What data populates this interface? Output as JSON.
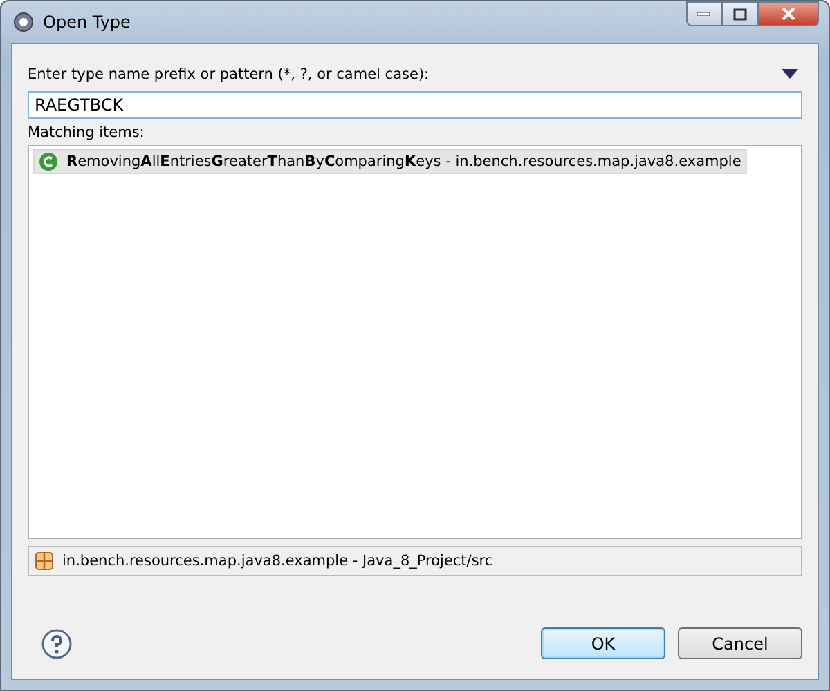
{
  "window": {
    "title": "Open Type"
  },
  "pattern": {
    "label": "Enter type name prefix or pattern (*, ?, or camel case):",
    "value": "RAEGTBCK"
  },
  "matching": {
    "label": "Matching items:",
    "items": [
      {
        "text": "**R**emoving**A**ll**E**ntries**G**reater**T**han**B**y**C**omparing**K**eys - in.bench.resources.map.java8.example",
        "selected": true
      }
    ]
  },
  "status_bar": {
    "text": "in.bench.resources.map.java8.example - Java_8_Project/src"
  },
  "buttons": [
    {
      "label": "OK",
      "default": true
    },
    {
      "label": "Cancel",
      "default": false
    }
  ]
}
